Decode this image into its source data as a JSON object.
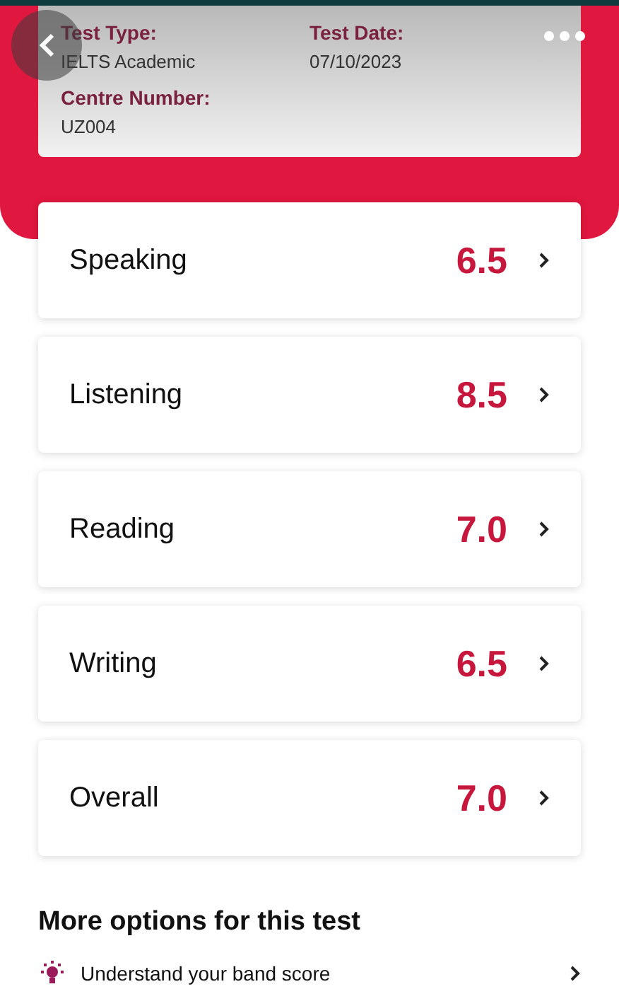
{
  "test_info": {
    "fields": [
      {
        "label": "Test Type:",
        "value": "IELTS Academic"
      },
      {
        "label": "Test Date:",
        "value": "07/10/2023"
      },
      {
        "label": "Centre Number:",
        "value": "UZ004"
      }
    ]
  },
  "scores": [
    {
      "skill": "Speaking",
      "score": "6.5"
    },
    {
      "skill": "Listening",
      "score": "8.5"
    },
    {
      "skill": "Reading",
      "score": "7.0"
    },
    {
      "skill": "Writing",
      "score": "6.5"
    },
    {
      "skill": "Overall",
      "score": "7.0"
    }
  ],
  "more_options": {
    "title": "More options for this test",
    "items": [
      {
        "label": "Understand your band score"
      }
    ]
  }
}
